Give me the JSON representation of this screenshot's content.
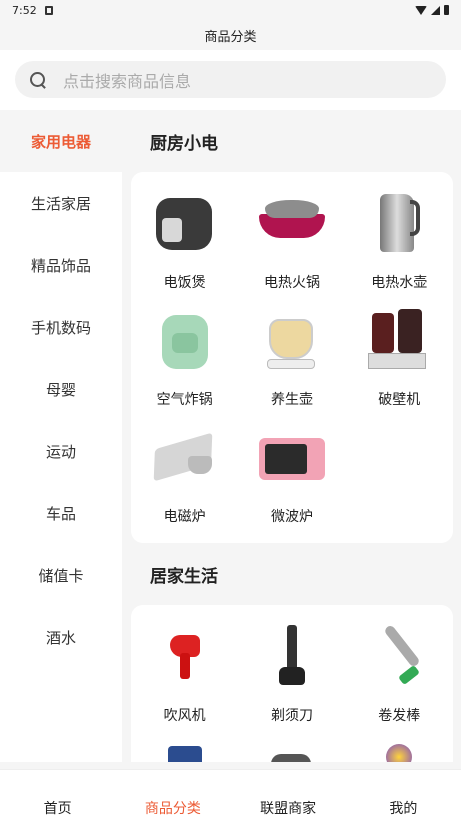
{
  "status": {
    "time": "7:52"
  },
  "header": {
    "title": "商品分类"
  },
  "search": {
    "placeholder": "点击搜索商品信息"
  },
  "sidebar": {
    "items": [
      {
        "label": "家用电器",
        "active": true
      },
      {
        "label": "生活家居",
        "active": false
      },
      {
        "label": "精品饰品",
        "active": false
      },
      {
        "label": "手机数码",
        "active": false
      },
      {
        "label": "母婴",
        "active": false
      },
      {
        "label": "运动",
        "active": false
      },
      {
        "label": "车品",
        "active": false
      },
      {
        "label": "储值卡",
        "active": false
      },
      {
        "label": "酒水",
        "active": false
      }
    ]
  },
  "sections": [
    {
      "title": "厨房小电",
      "products": [
        {
          "label": "电饭煲",
          "icon": "rice-cooker"
        },
        {
          "label": "电热火锅",
          "icon": "hot-pot"
        },
        {
          "label": "电热水壶",
          "icon": "kettle"
        },
        {
          "label": "空气炸锅",
          "icon": "air-fryer"
        },
        {
          "label": "养生壶",
          "icon": "health-pot"
        },
        {
          "label": "破壁机",
          "icon": "blender"
        },
        {
          "label": "电磁炉",
          "icon": "induction-cooker"
        },
        {
          "label": "微波炉",
          "icon": "microwave"
        }
      ]
    },
    {
      "title": "居家生活",
      "products": [
        {
          "label": "吹风机",
          "icon": "hair-dryer"
        },
        {
          "label": "剃须刀",
          "icon": "razor"
        },
        {
          "label": "卷发棒",
          "icon": "curling-iron"
        }
      ]
    }
  ],
  "tabbar": {
    "items": [
      {
        "label": "首页",
        "active": false
      },
      {
        "label": "商品分类",
        "active": true
      },
      {
        "label": "联盟商家",
        "active": false
      },
      {
        "label": "我的",
        "active": false
      }
    ]
  },
  "colors": {
    "accent": "#ec5b35",
    "background": "#f5f5f5"
  }
}
